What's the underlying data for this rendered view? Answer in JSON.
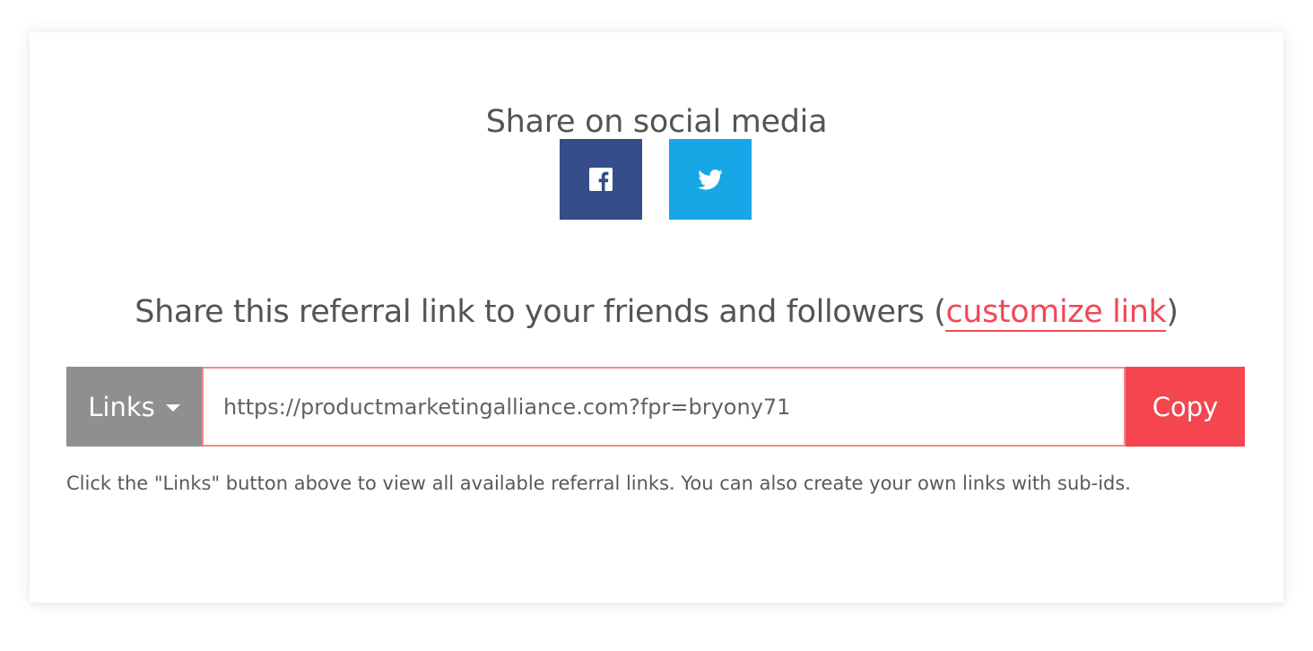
{
  "social": {
    "title": "Share on social media",
    "buttons": [
      {
        "network": "facebook",
        "icon": "facebook-icon",
        "color": "#354d89"
      },
      {
        "network": "twitter",
        "icon": "twitter-icon",
        "color": "#18a7e6"
      }
    ]
  },
  "referral": {
    "title_prefix": "Share this referral link to your friends and followers (",
    "customize_label": "customize link",
    "title_suffix": ")",
    "accent_color": "#f24855"
  },
  "link_bar": {
    "links_label": "Links",
    "url_value": "https://productmarketingalliance.com?fpr=bryony71",
    "copy_label": "Copy"
  },
  "help_text": "Click the \"Links\" button above to view all available referral links. You can also create your own links with sub-ids."
}
